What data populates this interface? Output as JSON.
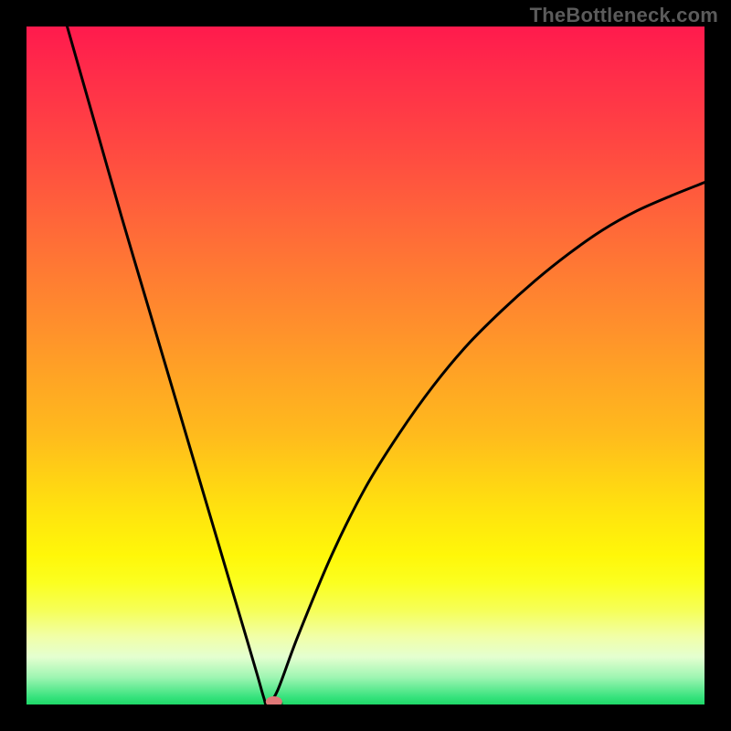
{
  "watermark": "TheBottleneck.com",
  "colors": {
    "page_bg": "#000000",
    "curve_stroke": "#000000",
    "marker_fill": "#e07878"
  },
  "chart_data": {
    "type": "line",
    "title": "",
    "xlabel": "",
    "ylabel": "",
    "xlim": [
      0,
      100
    ],
    "ylim": [
      0,
      100
    ],
    "grid": false,
    "notes": "V-shaped bottleneck curve on spectral gradient. Vertex near x≈35, left branch rises to 100 at x≈6, right branch curves up reaching ≈77 at x=100. A single salmon-colored marker sits at the valley.",
    "series": [
      {
        "name": "bottleneck-curve",
        "x": [
          6,
          10,
          14,
          18,
          22,
          26,
          30,
          32,
          34,
          35,
          35.5,
          37,
          40,
          45,
          50,
          55,
          60,
          65,
          70,
          75,
          80,
          85,
          90,
          95,
          100
        ],
        "y": [
          100,
          86,
          72,
          58.5,
          45,
          31.5,
          18,
          11.3,
          4.5,
          1,
          0,
          2,
          10,
          22,
          32,
          40,
          47,
          53,
          58,
          62.5,
          66.5,
          70,
          72.8,
          75,
          77
        ]
      }
    ],
    "marker": {
      "x": 36.5,
      "y": 0.4
    }
  }
}
